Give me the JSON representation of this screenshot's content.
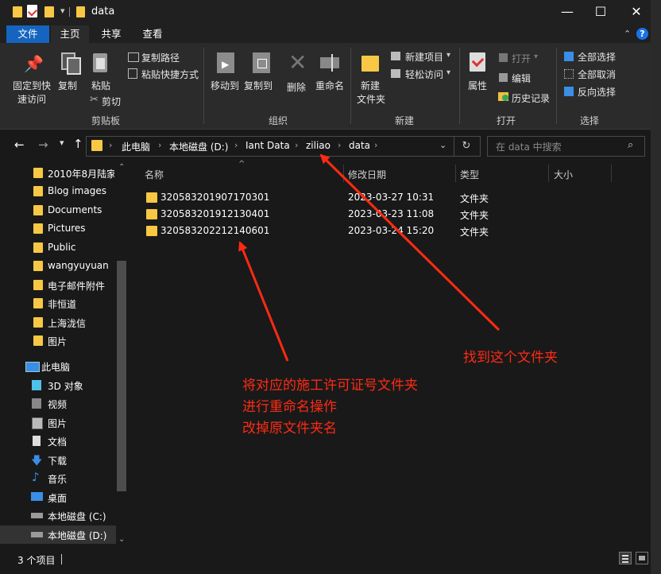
{
  "window": {
    "title": "data"
  },
  "menu": {
    "file": "文件",
    "home": "主页",
    "share": "共享",
    "view": "查看",
    "help": "?"
  },
  "ribbon": {
    "clipboard": {
      "pin": "固定到快速访问",
      "pin1": "固定到快",
      "pin2": "速访问",
      "copy": "复制",
      "paste": "粘贴",
      "copy_path": "复制路径",
      "paste_shortcut": "粘贴快捷方式",
      "cut": "剪切",
      "group": "剪贴板"
    },
    "organize": {
      "move_to": "移动到",
      "copy_to": "复制到",
      "delete": "删除",
      "rename": "重命名",
      "group": "组织"
    },
    "new": {
      "new_folder1": "新建",
      "new_folder2": "文件夹",
      "new_item": "新建项目",
      "easy_access": "轻松访问",
      "group": "新建"
    },
    "open": {
      "properties": "属性",
      "open": "打开",
      "edit": "编辑",
      "history": "历史记录",
      "group": "打开"
    },
    "select": {
      "select_all": "全部选择",
      "select_none": "全部取消",
      "invert": "反向选择",
      "group": "选择"
    }
  },
  "address": {
    "crumbs": [
      "此电脑",
      "本地磁盘 (D:)",
      "Iant Data",
      "ziliao",
      "data"
    ],
    "search_placeholder": "在 data 中搜索"
  },
  "nav": {
    "items": [
      "2010年8月陆家",
      "Blog images",
      "Documents",
      "Pictures",
      "Public",
      "wangyuyuan",
      "电子邮件附件",
      "非恒道",
      "上海泷信",
      "图片"
    ],
    "pc": "此电脑",
    "pc_items": [
      "3D 对象",
      "视频",
      "图片",
      "文档",
      "下载",
      "音乐",
      "桌面",
      "本地磁盘 (C:)",
      "本地磁盘 (D:)"
    ]
  },
  "columns": {
    "name": "名称",
    "date": "修改日期",
    "type": "类型",
    "size": "大小"
  },
  "files": [
    {
      "name": "320583201907170301",
      "date": "2023-03-27 10:31",
      "type": "文件夹"
    },
    {
      "name": "320583201912130401",
      "date": "2023-03-23 11:08",
      "type": "文件夹"
    },
    {
      "name": "320583202212140601",
      "date": "2023-03-24 15:20",
      "type": "文件夹"
    }
  ],
  "status": {
    "count": "3 个项目"
  },
  "annotations": {
    "find_folder": "找到这个文件夹",
    "line1": "将对应的施工许可证号文件夹",
    "line2": "进行重命名操作",
    "line3": "改掉原文件夹名"
  },
  "colors": {
    "accent": "#1565c0",
    "folder": "#f8c844",
    "annotation": "#ff2a14"
  }
}
